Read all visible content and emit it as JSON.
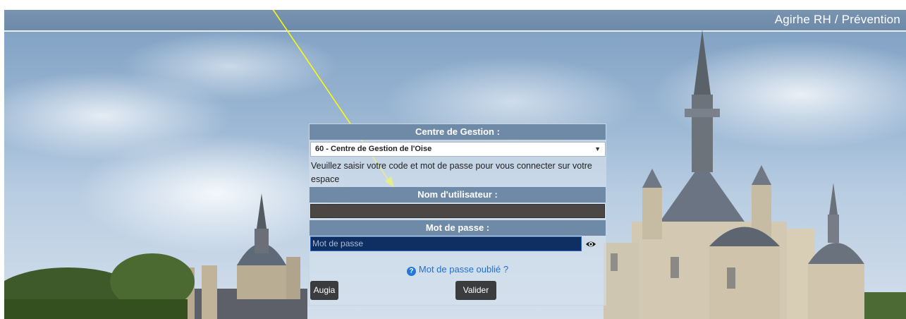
{
  "header": {
    "app_title": "Agirhe RH / Prévention"
  },
  "login": {
    "centre_label": "Centre de Gestion :",
    "centre_selected": "60 - Centre de Gestion de l'Oise",
    "info_text": "Veuillez saisir votre code et mot de passe pour vous connecter sur votre espace",
    "username_label": "Nom d'utilisateur :",
    "username_value": "",
    "password_label": "Mot de passe :",
    "password_placeholder": "Mot de passe",
    "forgot_link": "Mot de passe oublié ?",
    "augia_button": "Augia",
    "validate_button": "Valider"
  },
  "icons": {
    "select_caret": "caret-down-icon",
    "password_toggle": "eye-icon",
    "forgot_help": "question-circle-icon"
  },
  "colors": {
    "header_bar": "#6f8aa7",
    "password_field": "#0f2f63",
    "link": "#1f6fd1",
    "button": "#3b3c3d",
    "annotation_arrow": "#ffff00"
  }
}
